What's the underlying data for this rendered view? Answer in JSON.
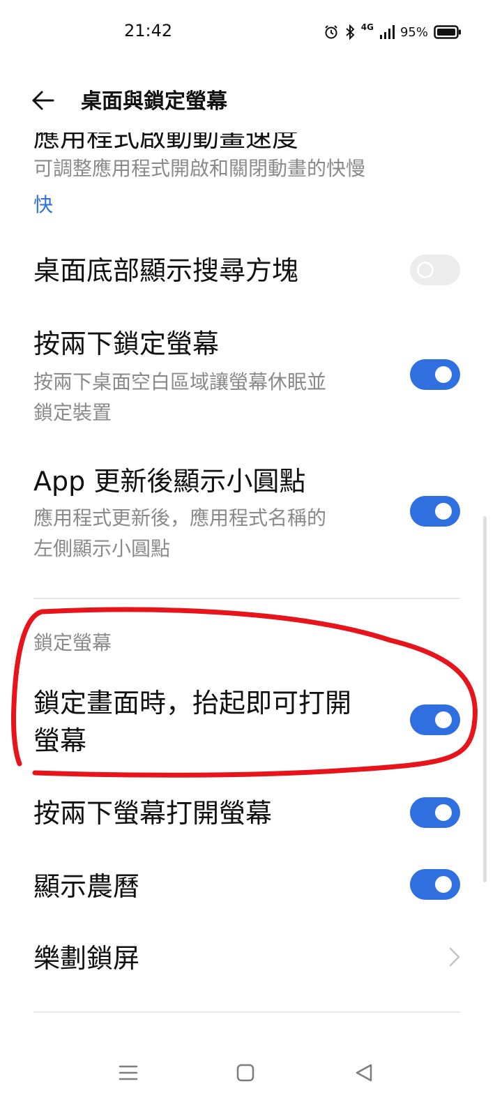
{
  "status_bar": {
    "time": "21:42",
    "network": "4G",
    "battery_percent": "95%",
    "icons": [
      "alarm-icon",
      "bluetooth-icon",
      "signal-icon",
      "battery-icon"
    ]
  },
  "header": {
    "title": "桌面與鎖定螢幕",
    "back_icon": "back-arrow-icon"
  },
  "items": {
    "anim_speed": {
      "title": "應用程式啟動動畫速度",
      "subtitle": "可調整應用程式開啟和關閉動畫的快慢",
      "value": "快"
    },
    "search_block": {
      "title": "桌面底部顯示搜尋方塊",
      "enabled": false
    },
    "double_tap_lock": {
      "title": "按兩下鎖定螢幕",
      "subtitle_line1": "按兩下桌面空白區域讓螢幕休眠並",
      "subtitle_line2": "鎖定裝置",
      "enabled": true
    },
    "app_update_dot": {
      "title": "App 更新後顯示小圓點",
      "subtitle_line1": "應用程式更新後，應用程式名稱的",
      "subtitle_line2": "左側顯示小圓點",
      "enabled": true
    }
  },
  "lock_section": {
    "header": "鎖定螢幕",
    "raise_to_wake": {
      "title_line1": "鎖定畫面時，抬起即可打開",
      "title_line2": "螢幕",
      "enabled": true
    },
    "double_tap_wake": {
      "title": "按兩下螢幕打開螢幕",
      "enabled": true
    },
    "lunar_calendar": {
      "title": "顯示農曆",
      "enabled": true
    },
    "lock_screen_app": {
      "title": "樂劃鎖屏"
    }
  },
  "colors": {
    "accent": "#2f6fe0",
    "annotation": "#e8141b",
    "toggle_off": "#ececec",
    "secondary_text": "#8a8a8a"
  },
  "nav_bar": {
    "icons": [
      "menu-icon",
      "home-icon",
      "back-icon"
    ]
  }
}
